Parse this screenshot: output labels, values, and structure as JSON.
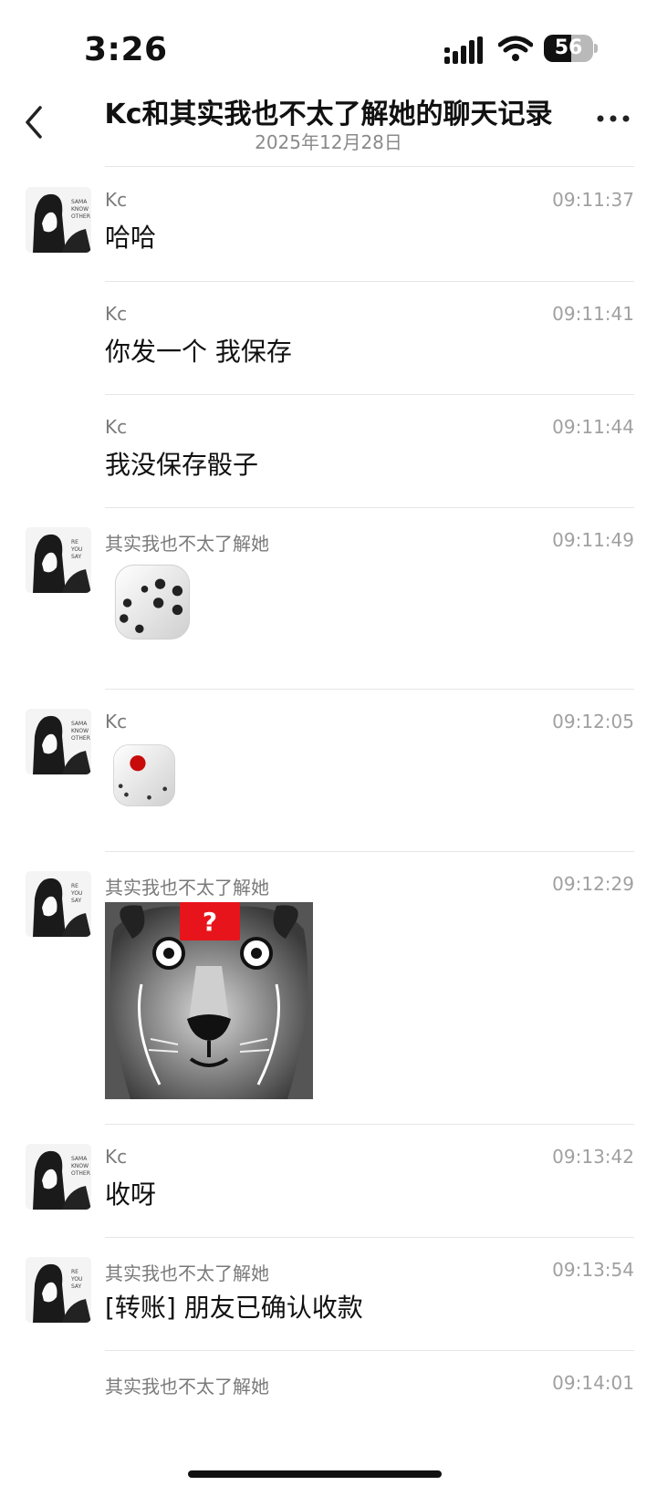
{
  "status_bar": {
    "time": "3:26",
    "battery": "56",
    "battery_level": 0.56
  },
  "header": {
    "title": "Kc和其实我也不太了解她的聊天记录",
    "subtitle": "2025年12月28日"
  },
  "messages": [
    {
      "sender": "Kc",
      "time": "09:11:37",
      "text": "哈哈",
      "type": "text",
      "show_avatar": true,
      "avatar": "avatar-kc"
    },
    {
      "sender": "Kc",
      "time": "09:11:41",
      "text": "你发一个 我保存",
      "type": "text",
      "show_avatar": false
    },
    {
      "sender": "Kc",
      "time": "09:11:44",
      "text": "我没保存骰子",
      "type": "text",
      "show_avatar": false
    },
    {
      "sender": "其实我也不太了解她",
      "time": "09:11:49",
      "type": "dice-sticker",
      "dice_face": 5,
      "show_avatar": true,
      "avatar": "avatar-other"
    },
    {
      "sender": "Kc",
      "time": "09:12:05",
      "type": "dice-sticker",
      "dice_face": 1,
      "show_avatar": true,
      "avatar": "avatar-kc"
    },
    {
      "sender": "其实我也不太了解她",
      "time": "09:12:29",
      "type": "image-sticker",
      "image_icon": "lion-question-icon",
      "overlay_text": "?",
      "show_avatar": true,
      "avatar": "avatar-other"
    },
    {
      "sender": "Kc",
      "time": "09:13:42",
      "text": "收呀",
      "type": "text",
      "show_avatar": true,
      "avatar": "avatar-kc"
    },
    {
      "sender": "其实我也不太了解她",
      "time": "09:13:54",
      "text": "[转账] 朋友已确认收款",
      "type": "text",
      "show_avatar": true,
      "avatar": "avatar-other"
    },
    {
      "sender": "其实我也不太了解她",
      "time": "09:14:01",
      "text": "",
      "type": "text",
      "show_avatar": false
    }
  ]
}
